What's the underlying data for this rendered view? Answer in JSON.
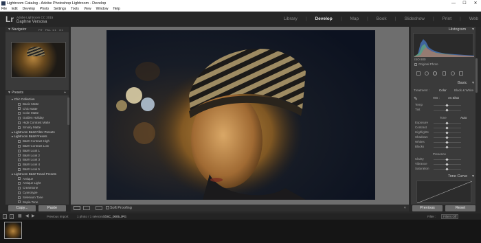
{
  "window": {
    "title": "Lightroom Catalog - Adobe Photoshop Lightroom - Develop",
    "controls": [
      "—",
      "☐",
      "✕"
    ]
  },
  "menu": [
    "File",
    "Edit",
    "Develop",
    "Photo",
    "Settings",
    "Tools",
    "View",
    "Window",
    "Help"
  ],
  "identity": {
    "logo": "Lr",
    "product": "Adobe Lightroom CC 2015",
    "user": "Daphne Versosa"
  },
  "modules": [
    "Library",
    "Develop",
    "Map",
    "Book",
    "Slideshow",
    "Print",
    "Web"
  ],
  "active_module": "Develop",
  "left_panel": {
    "navigator_label": "Navigator",
    "navigator_zoom": [
      "FIT",
      "FILL",
      "1:1",
      "3:1"
    ],
    "presets_label": "Presets",
    "presets": [
      {
        "label": "Chic Collection",
        "folder": true
      },
      {
        "label": "Basic Matte",
        "folder": false
      },
      {
        "label": "Chic Matte",
        "folder": false
      },
      {
        "label": "Color Matte",
        "folder": false
      },
      {
        "label": "Golden Holiday",
        "folder": false
      },
      {
        "label": "High Contrast Matte",
        "folder": false
      },
      {
        "label": "Smoky Matte",
        "folder": false
      },
      {
        "label": "Lightroom B&W Filter Presets",
        "folder": true
      },
      {
        "label": "Lightroom B&W Presets",
        "folder": true
      },
      {
        "label": "B&W Contrast High",
        "folder": false
      },
      {
        "label": "B&W Contrast Low",
        "folder": false
      },
      {
        "label": "B&W Look 1",
        "folder": false
      },
      {
        "label": "B&W Look 2",
        "folder": false
      },
      {
        "label": "B&W Look 3",
        "folder": false
      },
      {
        "label": "B&W Look 4",
        "folder": false
      },
      {
        "label": "B&W Look 5",
        "folder": false
      },
      {
        "label": "Lightroom B&W Toned Presets",
        "folder": true
      },
      {
        "label": "Antique",
        "folder": false
      },
      {
        "label": "Antique Light",
        "folder": false
      },
      {
        "label": "Creamtone",
        "folder": false
      },
      {
        "label": "Cyanotype",
        "folder": false
      },
      {
        "label": "Selenium Tone",
        "folder": false
      },
      {
        "label": "Sepia Tone",
        "folder": false
      }
    ],
    "copy_label": "Copy...",
    "paste_label": "Paste"
  },
  "toolbar": {
    "soft_proofing": "Soft Proofing"
  },
  "right_panel": {
    "histogram_label": "Histogram",
    "histogram_info": "ISO 800",
    "original_photo": "Original Photo",
    "basic_label": "Basic",
    "treatment_label": "Treatment :",
    "treatment_color": "Color",
    "treatment_bw": "Black & White",
    "wb_label": "WB :",
    "wb_value": "As Shot",
    "sliders_wb": [
      "Temp",
      "Tint"
    ],
    "tone_label": "Tone",
    "tone_auto": "Auto",
    "sliders_tone": [
      "Exposure",
      "Contrast",
      "Highlights",
      "Shadows",
      "Whites",
      "Blacks"
    ],
    "presence_label": "Presence",
    "sliders_presence": [
      "Clarity",
      "Vibrance",
      "Saturation"
    ],
    "tone_curve_label": "Tone Curve",
    "previous_label": "Previous",
    "reset_label": "Reset"
  },
  "filmstrip": {
    "source": "Previous Import",
    "count": "1 photo / 1 selected /",
    "filename": "DSC_0005.JPG",
    "filter_label": "Filter :",
    "filter_value": "Filters Off",
    "page_numbers": [
      "1",
      "2"
    ]
  },
  "colors": {
    "panel_bg": "#3a3a3a",
    "center_bg": "#6e6e6e",
    "accent_histogram_blue": "#4a7fd0",
    "accent_histogram_green": "#6fbf6f"
  }
}
